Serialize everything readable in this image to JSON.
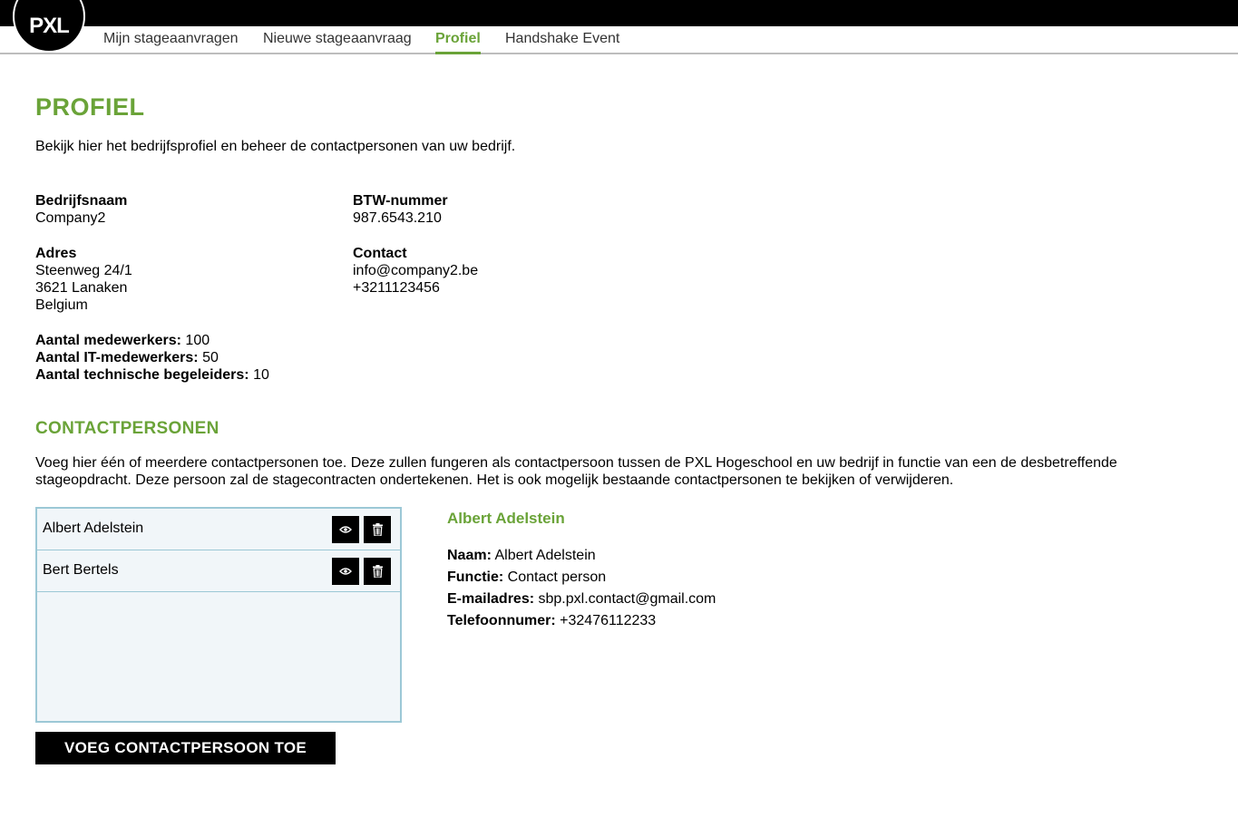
{
  "app": {
    "logo_text": "PXL"
  },
  "nav": {
    "items": [
      {
        "label": "Mijn stageaanvragen",
        "active": false
      },
      {
        "label": "Nieuwe stageaanvraag",
        "active": false
      },
      {
        "label": "Profiel",
        "active": true
      },
      {
        "label": "Handshake Event",
        "active": false
      }
    ]
  },
  "page": {
    "title": "PROFIEL",
    "intro": "Bekijk hier het bedrijfsprofiel en beheer de contactpersonen van uw bedrijf."
  },
  "company": {
    "name_label": "Bedrijfsnaam",
    "name": "Company2",
    "vat_label": "BTW-nummer",
    "vat": "987.6543.210",
    "address_label": "Adres",
    "address_line1": "Steenweg 24/1",
    "address_line2": "3621 Lanaken",
    "address_country": "Belgium",
    "contact_label": "Contact",
    "contact_email": "info@company2.be",
    "contact_phone": "+3211123456",
    "employees_label": "Aantal medewerkers:",
    "employees": "100",
    "it_employees_label": "Aantal IT-medewerkers:",
    "it_employees": "50",
    "tech_supervisors_label": "Aantal technische begeleiders:",
    "tech_supervisors": "10"
  },
  "contacts": {
    "title": "CONTACTPERSONEN",
    "description": "Voeg hier één of meerdere contactpersonen toe. Deze zullen fungeren als contactpersoon tussen de PXL Hogeschool en uw bedrijf in functie van een de desbetreffende stageopdracht. Deze persoon zal de stagecontracten ondertekenen. Het is ook mogelijk bestaande contactpersonen te bekijken of verwijderen.",
    "list": [
      {
        "name": "Albert Adelstein"
      },
      {
        "name": "Bert Bertels"
      }
    ],
    "add_button_label": "VOEG CONTACTPERSOON TOE"
  },
  "selected_contact": {
    "title": "Albert Adelstein",
    "name_label": "Naam:",
    "name": "Albert Adelstein",
    "function_label": "Functie:",
    "function": "Contact person",
    "email_label": "E-mailadres:",
    "email": "sbp.pxl.contact@gmail.com",
    "phone_label": "Telefoonnumer:",
    "phone": "+32476112233"
  },
  "colors": {
    "accent": "#6aa338",
    "list_border": "#9cc8d6",
    "list_bg": "#f1f6f9"
  }
}
